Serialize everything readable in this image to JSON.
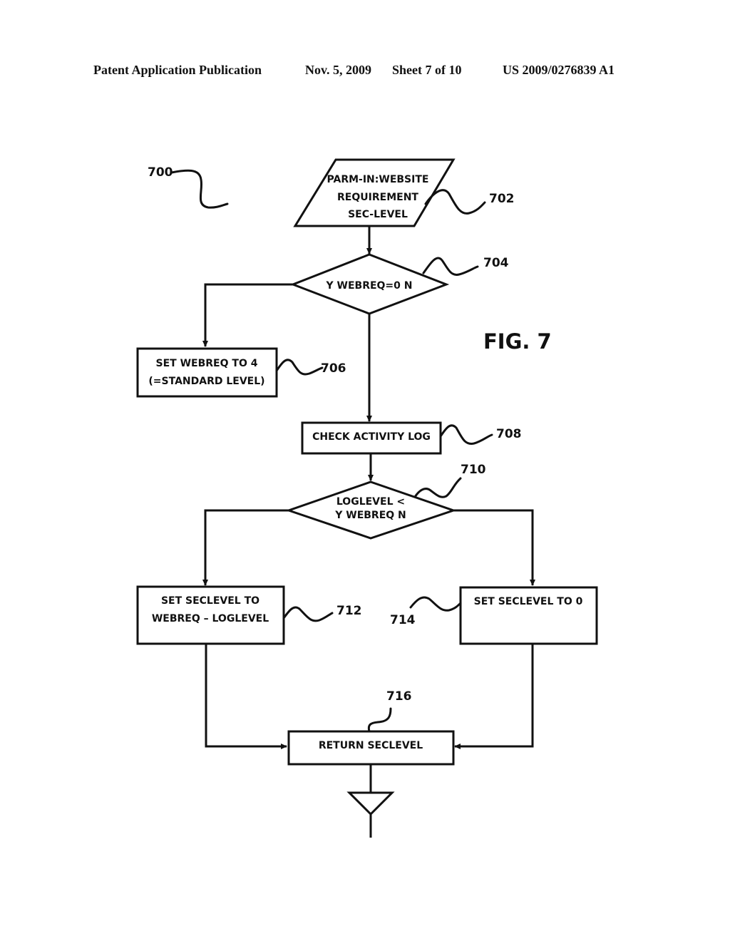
{
  "header": {
    "publication": "Patent Application Publication",
    "date": "Nov. 5, 2009",
    "sheet": "Sheet 7 of 10",
    "number": "US 2009/0276839 A1"
  },
  "figure": {
    "label": "FIG. 7",
    "ref": "700"
  },
  "nodes": {
    "n702": {
      "ref": "702",
      "type": "input",
      "lines": [
        "PARM-IN:WEBSITE",
        "REQUIREMENT",
        "SEC-LEVEL"
      ]
    },
    "n704": {
      "ref": "704",
      "type": "decision",
      "lines": [
        "Y  WEBREQ=0  N"
      ],
      "yes": "Y",
      "no": "N"
    },
    "n706": {
      "ref": "706",
      "type": "process",
      "lines": [
        "SET WEBREQ TO 4",
        "(=STANDARD LEVEL)"
      ]
    },
    "n708": {
      "ref": "708",
      "type": "process",
      "lines": [
        "CHECK ACTIVITY LOG"
      ]
    },
    "n710": {
      "ref": "710",
      "type": "decision",
      "lines": [
        "LOGLEVEL <",
        "Y WEBREQ N"
      ],
      "yes": "Y",
      "no": "N"
    },
    "n712": {
      "ref": "712",
      "type": "process",
      "lines": [
        "SET SECLEVEL TO",
        "WEBREQ – LOGLEVEL"
      ]
    },
    "n714": {
      "ref": "714",
      "type": "process",
      "lines": [
        "SET SECLEVEL TO 0"
      ]
    },
    "n716": {
      "ref": "716",
      "type": "process",
      "lines": [
        "RETURN SECLEVEL"
      ]
    }
  },
  "edges": [
    {
      "from": "702",
      "to": "704"
    },
    {
      "from": "704",
      "to": "706",
      "label": "Y"
    },
    {
      "from": "704",
      "to": "708",
      "label": "N"
    },
    {
      "from": "708",
      "to": "710"
    },
    {
      "from": "710",
      "to": "712",
      "label": "Y"
    },
    {
      "from": "710",
      "to": "714",
      "label": "N"
    },
    {
      "from": "712",
      "to": "716"
    },
    {
      "from": "714",
      "to": "716"
    },
    {
      "from": "716",
      "to": "end"
    }
  ]
}
